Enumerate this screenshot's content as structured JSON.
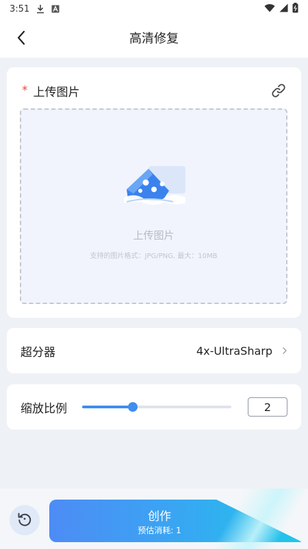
{
  "status_bar": {
    "time": "3:51",
    "left_icons": [
      "download-icon",
      "a-badge-icon"
    ],
    "right_icons": [
      "wifi-icon",
      "signal-icon",
      "battery-icon"
    ]
  },
  "app_bar": {
    "title": "高清修复",
    "back_icon": "chevron-left-icon"
  },
  "upload": {
    "required_mark": "*",
    "label": "上传图片",
    "link_icon": "link-icon",
    "dropzone_title": "上传图片",
    "dropzone_hint": "支持的图片格式：JPG/PNG, 最大：10MB"
  },
  "upscaler": {
    "label": "超分器",
    "value": "4x-UltraSharp",
    "chevron_icon": "chevron-right-icon"
  },
  "scale": {
    "label": "缩放比例",
    "value": "2",
    "slider_fraction": 0.34
  },
  "bottom": {
    "reset_icon": "reset-icon",
    "create_label": "创作",
    "cost_label": "预估消耗: 1"
  },
  "colors": {
    "accent": "#3f8df0",
    "required": "#e04b4b",
    "page_bg": "#eef1f5",
    "button_gradient_start": "#4d8cf5",
    "button_gradient_end": "#1fc8ea"
  }
}
